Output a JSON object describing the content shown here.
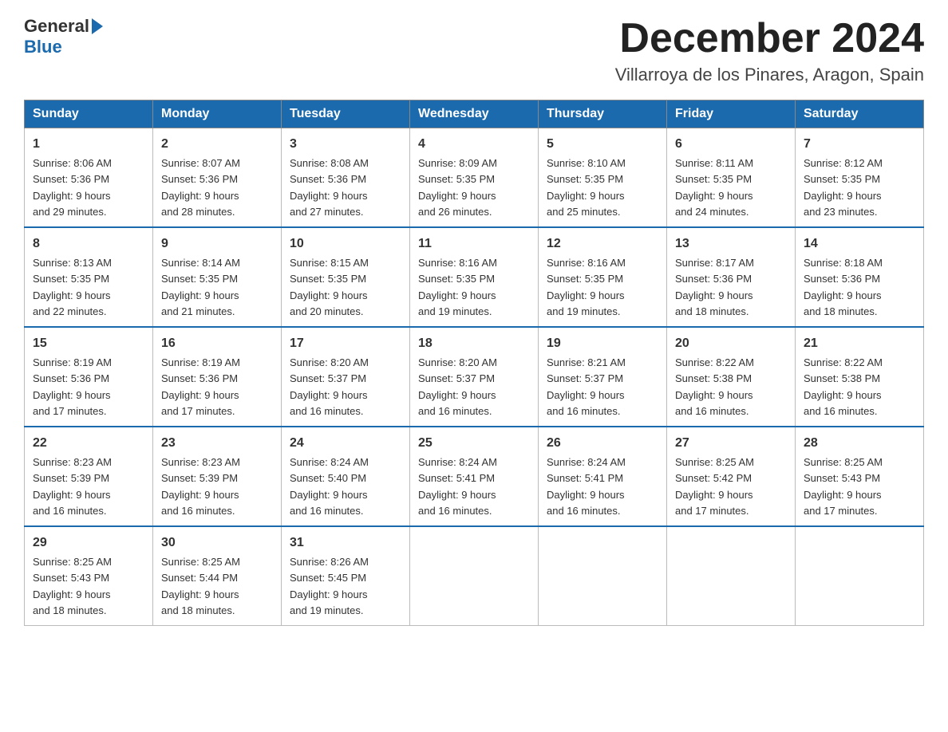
{
  "logo": {
    "general": "General",
    "blue": "Blue"
  },
  "title": "December 2024",
  "subtitle": "Villarroya de los Pinares, Aragon, Spain",
  "days_of_week": [
    "Sunday",
    "Monday",
    "Tuesday",
    "Wednesday",
    "Thursday",
    "Friday",
    "Saturday"
  ],
  "weeks": [
    [
      {
        "day": "1",
        "sunrise": "8:06 AM",
        "sunset": "5:36 PM",
        "daylight": "9 hours and 29 minutes."
      },
      {
        "day": "2",
        "sunrise": "8:07 AM",
        "sunset": "5:36 PM",
        "daylight": "9 hours and 28 minutes."
      },
      {
        "day": "3",
        "sunrise": "8:08 AM",
        "sunset": "5:36 PM",
        "daylight": "9 hours and 27 minutes."
      },
      {
        "day": "4",
        "sunrise": "8:09 AM",
        "sunset": "5:35 PM",
        "daylight": "9 hours and 26 minutes."
      },
      {
        "day": "5",
        "sunrise": "8:10 AM",
        "sunset": "5:35 PM",
        "daylight": "9 hours and 25 minutes."
      },
      {
        "day": "6",
        "sunrise": "8:11 AM",
        "sunset": "5:35 PM",
        "daylight": "9 hours and 24 minutes."
      },
      {
        "day": "7",
        "sunrise": "8:12 AM",
        "sunset": "5:35 PM",
        "daylight": "9 hours and 23 minutes."
      }
    ],
    [
      {
        "day": "8",
        "sunrise": "8:13 AM",
        "sunset": "5:35 PM",
        "daylight": "9 hours and 22 minutes."
      },
      {
        "day": "9",
        "sunrise": "8:14 AM",
        "sunset": "5:35 PM",
        "daylight": "9 hours and 21 minutes."
      },
      {
        "day": "10",
        "sunrise": "8:15 AM",
        "sunset": "5:35 PM",
        "daylight": "9 hours and 20 minutes."
      },
      {
        "day": "11",
        "sunrise": "8:16 AM",
        "sunset": "5:35 PM",
        "daylight": "9 hours and 19 minutes."
      },
      {
        "day": "12",
        "sunrise": "8:16 AM",
        "sunset": "5:35 PM",
        "daylight": "9 hours and 19 minutes."
      },
      {
        "day": "13",
        "sunrise": "8:17 AM",
        "sunset": "5:36 PM",
        "daylight": "9 hours and 18 minutes."
      },
      {
        "day": "14",
        "sunrise": "8:18 AM",
        "sunset": "5:36 PM",
        "daylight": "9 hours and 18 minutes."
      }
    ],
    [
      {
        "day": "15",
        "sunrise": "8:19 AM",
        "sunset": "5:36 PM",
        "daylight": "9 hours and 17 minutes."
      },
      {
        "day": "16",
        "sunrise": "8:19 AM",
        "sunset": "5:36 PM",
        "daylight": "9 hours and 17 minutes."
      },
      {
        "day": "17",
        "sunrise": "8:20 AM",
        "sunset": "5:37 PM",
        "daylight": "9 hours and 16 minutes."
      },
      {
        "day": "18",
        "sunrise": "8:20 AM",
        "sunset": "5:37 PM",
        "daylight": "9 hours and 16 minutes."
      },
      {
        "day": "19",
        "sunrise": "8:21 AM",
        "sunset": "5:37 PM",
        "daylight": "9 hours and 16 minutes."
      },
      {
        "day": "20",
        "sunrise": "8:22 AM",
        "sunset": "5:38 PM",
        "daylight": "9 hours and 16 minutes."
      },
      {
        "day": "21",
        "sunrise": "8:22 AM",
        "sunset": "5:38 PM",
        "daylight": "9 hours and 16 minutes."
      }
    ],
    [
      {
        "day": "22",
        "sunrise": "8:23 AM",
        "sunset": "5:39 PM",
        "daylight": "9 hours and 16 minutes."
      },
      {
        "day": "23",
        "sunrise": "8:23 AM",
        "sunset": "5:39 PM",
        "daylight": "9 hours and 16 minutes."
      },
      {
        "day": "24",
        "sunrise": "8:24 AM",
        "sunset": "5:40 PM",
        "daylight": "9 hours and 16 minutes."
      },
      {
        "day": "25",
        "sunrise": "8:24 AM",
        "sunset": "5:41 PM",
        "daylight": "9 hours and 16 minutes."
      },
      {
        "day": "26",
        "sunrise": "8:24 AM",
        "sunset": "5:41 PM",
        "daylight": "9 hours and 16 minutes."
      },
      {
        "day": "27",
        "sunrise": "8:25 AM",
        "sunset": "5:42 PM",
        "daylight": "9 hours and 17 minutes."
      },
      {
        "day": "28",
        "sunrise": "8:25 AM",
        "sunset": "5:43 PM",
        "daylight": "9 hours and 17 minutes."
      }
    ],
    [
      {
        "day": "29",
        "sunrise": "8:25 AM",
        "sunset": "5:43 PM",
        "daylight": "9 hours and 18 minutes."
      },
      {
        "day": "30",
        "sunrise": "8:25 AM",
        "sunset": "5:44 PM",
        "daylight": "9 hours and 18 minutes."
      },
      {
        "day": "31",
        "sunrise": "8:26 AM",
        "sunset": "5:45 PM",
        "daylight": "9 hours and 19 minutes."
      },
      null,
      null,
      null,
      null
    ]
  ],
  "labels": {
    "sunrise": "Sunrise:",
    "sunset": "Sunset:",
    "daylight": "Daylight:"
  }
}
